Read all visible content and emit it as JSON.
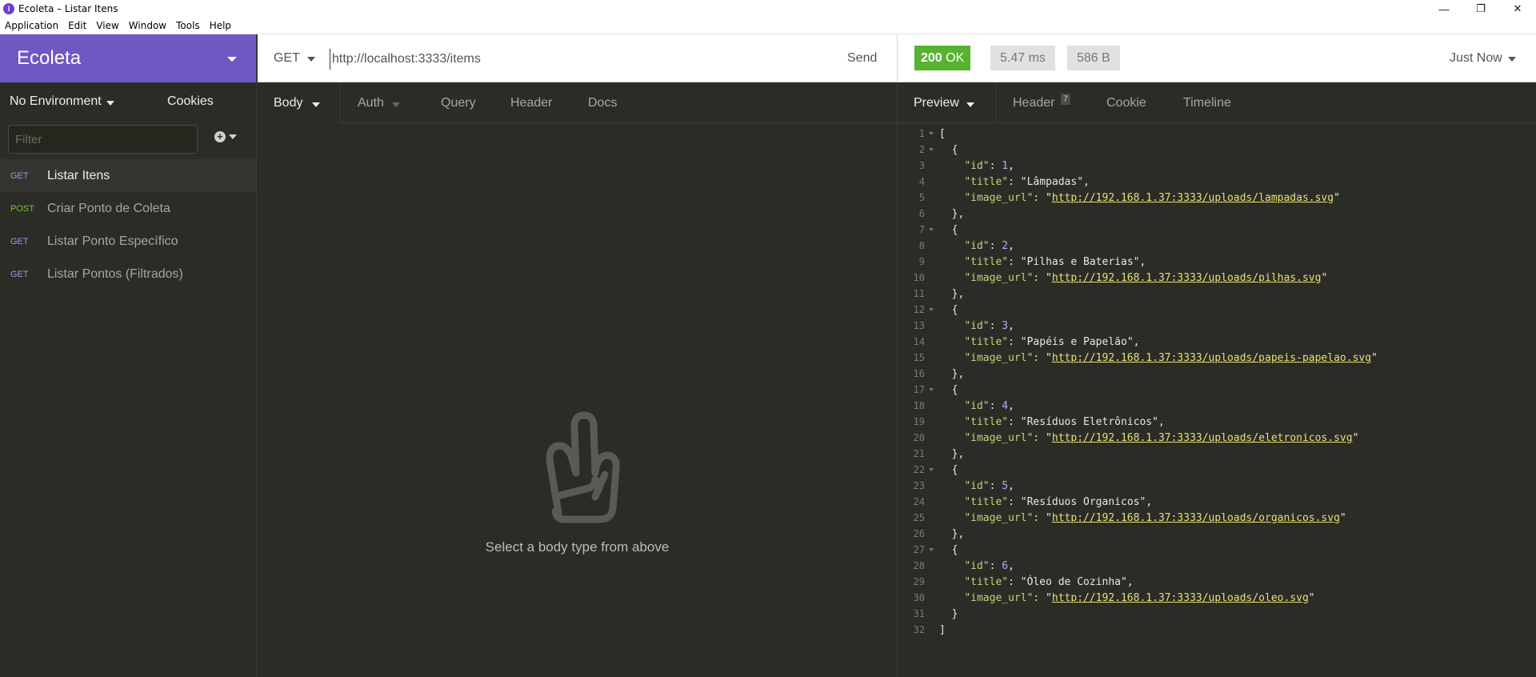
{
  "window": {
    "title": "Ecoleta – Listar Itens",
    "icon_letter": "I"
  },
  "menu": [
    "Application",
    "Edit",
    "View",
    "Window",
    "Tools",
    "Help"
  ],
  "sidebar": {
    "workspace": "Ecoleta",
    "environment": "No Environment",
    "cookies": "Cookies",
    "filter_placeholder": "Filter",
    "requests": [
      {
        "method": "GET",
        "label": "Listar Itens",
        "active": true
      },
      {
        "method": "POST",
        "label": "Criar Ponto de Coleta",
        "active": false
      },
      {
        "method": "GET",
        "label": "Listar Ponto Específico",
        "active": false
      },
      {
        "method": "GET",
        "label": "Listar Pontos (Filtrados)",
        "active": false
      }
    ]
  },
  "request": {
    "method": "GET",
    "url": "http://localhost:3333/items",
    "send": "Send",
    "tabs": [
      "Body",
      "Auth",
      "Query",
      "Header",
      "Docs"
    ],
    "empty_message": "Select a body type from above"
  },
  "response": {
    "status_code": "200",
    "status_text": "OK",
    "time": "5.47 ms",
    "size": "586 B",
    "when": "Just Now",
    "tabs": [
      "Preview",
      "Header",
      "Cookie",
      "Timeline"
    ],
    "header_count": "7",
    "items": [
      {
        "id": "1",
        "title": "Lâmpadas",
        "image_url": "http://192.168.1.37:3333/uploads/lampadas.svg"
      },
      {
        "id": "2",
        "title": "Pilhas e Baterias",
        "image_url": "http://192.168.1.37:3333/uploads/pilhas.svg"
      },
      {
        "id": "3",
        "title": "Papéis e Papelão",
        "image_url": "http://192.168.1.37:3333/uploads/papeis-papelao.svg"
      },
      {
        "id": "4",
        "title": "Resíduos Eletrônicos",
        "image_url": "http://192.168.1.37:3333/uploads/eletronicos.svg"
      },
      {
        "id": "5",
        "title": "Resíduos Organicos",
        "image_url": "http://192.168.1.37:3333/uploads/organicos.svg"
      },
      {
        "id": "6",
        "title": "Óleo de Cozinha",
        "image_url": "http://192.168.1.37:3333/uploads/oleo.svg"
      }
    ]
  },
  "colors": {
    "workspace_header": "#6e59c3",
    "status_ok": "#55b330",
    "get_method": "#a394e8",
    "post_method": "#72c232"
  }
}
